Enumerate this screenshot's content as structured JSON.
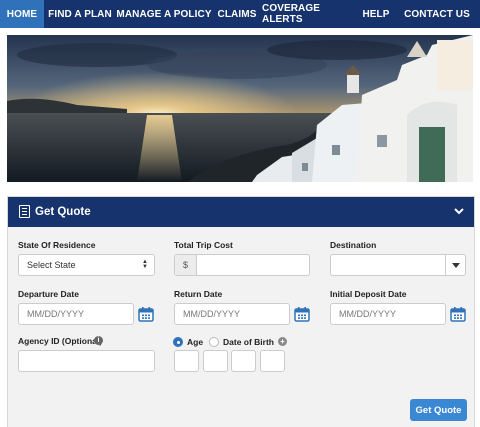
{
  "nav": {
    "items": [
      {
        "label": "HOME",
        "active": true
      },
      {
        "label": "FIND A PLAN",
        "active": false
      },
      {
        "label": "MANAGE A POLICY",
        "active": false
      },
      {
        "label": "CLAIMS",
        "active": false
      },
      {
        "label": "COVERAGE ALERTS",
        "active": false
      },
      {
        "label": "HELP",
        "active": false
      },
      {
        "label": "CONTACT US",
        "active": false
      }
    ]
  },
  "hero": {
    "image": "santorini-sunset-photo"
  },
  "quote": {
    "title": "Get Quote",
    "state_label": "State Of Residence",
    "state_value": "Select State",
    "cost_label": "Total Trip Cost",
    "cost_prefix": "$",
    "destination_label": "Destination",
    "departure_label": "Departure Date",
    "departure_placeholder": "MM/DD/YYYY",
    "return_label": "Return Date",
    "return_placeholder": "MM/DD/YYYY",
    "deposit_label": "Initial Deposit Date",
    "deposit_placeholder": "MM/DD/YYYY",
    "agency_label": "Agency ID (Optional)",
    "age_option": "Age",
    "dob_option": "Date of Birth",
    "submit_label": "Get Quote"
  },
  "colors": {
    "nav": "#16336d",
    "nav_active": "#2f72b9",
    "button": "#3a88d4",
    "calendar": "#2f72b9"
  }
}
